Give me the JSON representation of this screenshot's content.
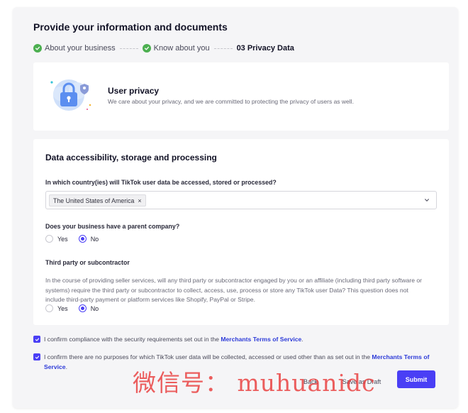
{
  "page": {
    "title": "Provide your information and documents"
  },
  "stepper": {
    "steps": [
      {
        "label": "About your business",
        "status": "done"
      },
      {
        "label": "Know about you",
        "status": "done"
      },
      {
        "number": "03",
        "label": "Privacy Data",
        "status": "active"
      }
    ]
  },
  "privacy": {
    "title": "User privacy",
    "description": "We care about your privacy, and we are committed to protecting the privacy of users as well."
  },
  "data_section": {
    "title": "Data accessibility, storage and processing",
    "country_question": "In which country(ies) will TikTok user data be accessed, stored or processed?",
    "selected_countries": [
      "The United States of America"
    ],
    "remove_glyph": "×",
    "parent_company_question": "Does your business have a parent company?",
    "parent_company_options": [
      "Yes",
      "No"
    ],
    "parent_company_selected": "No",
    "third_party_question": "Third party or subcontractor",
    "third_party_description": "In the course of providing seller services, will any third party or subcontractor engaged by you or an affiliate (including third party software or systems) require the third party or subcontractor to collect, access, use, process or store any TikTok user Data? This question does not include third-party payment or platform services like Shopify, PayPal or Stripe.",
    "third_party_options": [
      "Yes",
      "No"
    ],
    "third_party_selected": "No"
  },
  "confirmations": [
    {
      "checked": true,
      "text": "I confirm compliance with the security requirements set out in the ",
      "link": "Merchants Terms of Service",
      "suffix": "."
    },
    {
      "checked": true,
      "text": "I confirm there are no purposes for which TikTok user data will be collected, accessed or used other than as set out in the ",
      "link": "Merchants Terms of Service",
      "suffix": "."
    }
  ],
  "actions": {
    "back_label": "Back",
    "draft_label": "Save as Draft",
    "submit_label": "Submit"
  },
  "watermark": {
    "text": "微信号： muhuanidc"
  },
  "colors": {
    "primary": "#4a3ff5",
    "success": "#4caf50",
    "link": "#2d3bd8",
    "watermark": "#e83232"
  },
  "icons": {
    "done_step": "check-circle-icon",
    "dropdown": "chevron-down-icon",
    "privacy": "lock-shield-illustration",
    "checkbox": "checkmark-icon"
  }
}
